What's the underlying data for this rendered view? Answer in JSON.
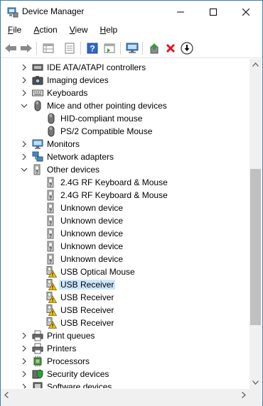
{
  "window": {
    "title": "Device Manager"
  },
  "menu": {
    "file": "File",
    "action": "Action",
    "view": "View",
    "help": "Help"
  },
  "toolbar": {
    "icons": [
      "back-icon",
      "forward-icon",
      "properties-grid-icon",
      "show-hide-icon",
      "help-icon",
      "action-pane-icon",
      "monitor-icon",
      "update-driver-icon",
      "uninstall-icon",
      "disable-icon"
    ]
  },
  "tree": {
    "rows": [
      {
        "label": "IDE ATA/ATAPI controllers",
        "level": 1,
        "expanded": false,
        "icon": "ide-controller-icon"
      },
      {
        "label": "Imaging devices",
        "level": 1,
        "expanded": false,
        "icon": "camera-icon"
      },
      {
        "label": "Keyboards",
        "level": 1,
        "expanded": false,
        "icon": "keyboard-icon"
      },
      {
        "label": "Mice and other pointing devices",
        "level": 1,
        "expanded": true,
        "icon": "mouse-icon"
      },
      {
        "label": "HID-compliant mouse",
        "level": 2,
        "icon": "mouse-icon"
      },
      {
        "label": "PS/2 Compatible Mouse",
        "level": 2,
        "icon": "mouse-icon"
      },
      {
        "label": "Monitors",
        "level": 1,
        "expanded": false,
        "icon": "monitor-icon"
      },
      {
        "label": "Network adapters",
        "level": 1,
        "expanded": false,
        "icon": "network-adapter-icon"
      },
      {
        "label": "Other devices",
        "level": 1,
        "expanded": true,
        "icon": "unknown-device-icon"
      },
      {
        "label": "2.4G RF Keyboard & Mouse",
        "level": 2,
        "icon": "unknown-device-icon"
      },
      {
        "label": "2.4G RF Keyboard & Mouse",
        "level": 2,
        "icon": "unknown-device-icon"
      },
      {
        "label": "Unknown device",
        "level": 2,
        "icon": "unknown-device-icon"
      },
      {
        "label": "Unknown device",
        "level": 2,
        "icon": "unknown-device-icon"
      },
      {
        "label": "Unknown device",
        "level": 2,
        "icon": "unknown-device-icon"
      },
      {
        "label": "Unknown device",
        "level": 2,
        "icon": "unknown-device-icon"
      },
      {
        "label": "Unknown device",
        "level": 2,
        "icon": "unknown-device-icon"
      },
      {
        "label": "USB Optical Mouse",
        "level": 2,
        "icon": "warning-device-icon"
      },
      {
        "label": "USB Receiver",
        "level": 2,
        "icon": "warning-device-icon",
        "selected": true
      },
      {
        "label": "USB Receiver",
        "level": 2,
        "icon": "warning-device-icon"
      },
      {
        "label": "USB Receiver",
        "level": 2,
        "icon": "warning-device-icon"
      },
      {
        "label": "USB Receiver",
        "level": 2,
        "icon": "warning-device-icon"
      },
      {
        "label": "Print queues",
        "level": 1,
        "expanded": false,
        "icon": "printer-icon"
      },
      {
        "label": "Printers",
        "level": 1,
        "expanded": false,
        "icon": "printer-icon"
      },
      {
        "label": "Processors",
        "level": 1,
        "expanded": false,
        "icon": "processor-icon"
      },
      {
        "label": "Security devices",
        "level": 1,
        "expanded": false,
        "icon": "security-device-icon"
      },
      {
        "label": "Software devices",
        "level": 1,
        "expanded": false,
        "icon": "software-device-icon"
      }
    ]
  },
  "colors": {
    "selection": "#cce8ff",
    "warning": "#f2c200",
    "error_red": "#e81123",
    "green": "#2e9e3a"
  }
}
